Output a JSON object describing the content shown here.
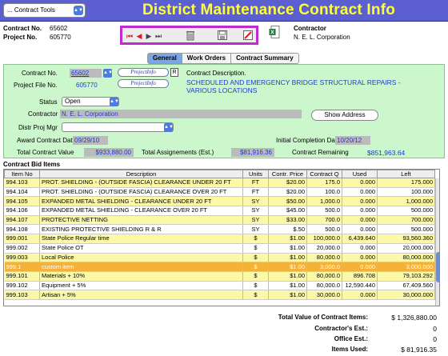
{
  "toolbar_menu": {
    "label": "... Contract Tools"
  },
  "title": "District Maintenance Contract Info",
  "header": {
    "contract_no_label": "Contract No.",
    "contract_no": "65602",
    "project_no_label": "Project No.",
    "project_no": "605770",
    "contractor_label": "Contractor",
    "contractor": "N. E. L. Corporation"
  },
  "nav_buttons": {
    "first": "⏮",
    "prev": "◀",
    "next": "▶",
    "last": "⏭"
  },
  "tabs": [
    {
      "label": "General"
    },
    {
      "label": "Work Orders"
    },
    {
      "label": "Contract Summary"
    }
  ],
  "form": {
    "contract_no_label": "Contract No.",
    "contract_no": "65602",
    "projectinfo_logo": "ProjectInfo",
    "r_label": "R",
    "contract_description_label": "Contract Description.",
    "project_file_no_label": "Project File No.",
    "project_file_no": "605770",
    "description": "SCHEDULED AND EMERGENCY BRIDGE STRUCTURAL REPAIRS - VARIOUS LOCATIONS",
    "status_label": "Status",
    "status_value": "Open",
    "contractor_label": "Contractor",
    "contractor_value": "N. E. L. Corporation",
    "show_address": "Show Address",
    "distr_proj_mgr_label": "Distr Proj Mgr",
    "distr_proj_mgr_value": "",
    "award_date_label": "Award Contract Date",
    "award_date": "09/29/10",
    "completion_date_label": "Initial Completion Date",
    "completion_date": "10/20/12",
    "total_value_label": "Total Contract Value",
    "total_value": "$933,880.00",
    "total_assign_label": "Total Assignements (Est.)",
    "total_assign": "$81,916.36",
    "contract_remaining_label": "Contract Remaining",
    "contract_remaining": "$851,963.64"
  },
  "bid_items": {
    "title": "Contract Bid Items",
    "columns": [
      "Item No",
      "Description",
      "Units",
      "Contr. Price",
      "Contract Q",
      "Used",
      "Left"
    ],
    "rows": [
      {
        "item": "994.103",
        "desc": "PROT. SHIELDING - (OUTSIDE FASCIA) CLEARANCE UNDER 20 FT",
        "units": "FT",
        "price": "$20.00",
        "qty": "175.0",
        "used": "0.000",
        "left": "175.000",
        "style": "yellow"
      },
      {
        "item": "994.104",
        "desc": "PROT. SHIELDING - (OUTSIDE FASCIA) CLEARANCE OVER 20 FT",
        "units": "FT",
        "price": "$20.00",
        "qty": "100.0",
        "used": "0.000",
        "left": "100.000",
        "style": "white"
      },
      {
        "item": "994.105",
        "desc": "EXPANDED METAL SHIELDING - CLEARANCE UNDER 20 FT",
        "units": "SY",
        "price": "$50.00",
        "qty": "1,000.0",
        "used": "0.000",
        "left": "1,000.000",
        "style": "yellow"
      },
      {
        "item": "994.106",
        "desc": "EXPANDED METAL SHIELDING - CLEARANCE OVER 20 FT",
        "units": "SY",
        "price": "$45.00",
        "qty": "500.0",
        "used": "0.000",
        "left": "500.000",
        "style": "white"
      },
      {
        "item": "994.107",
        "desc": "PROTECTIVE NETTING",
        "units": "SY",
        "price": "$33.00",
        "qty": "700.0",
        "used": "0.000",
        "left": "700.000",
        "style": "yellow"
      },
      {
        "item": "994.108",
        "desc": "EXISTING PROTECTIVE SHIELDING R & R",
        "units": "SY",
        "price": "$.50",
        "qty": "500.0",
        "used": "0.000",
        "left": "500.000",
        "style": "white"
      },
      {
        "item": "999.001",
        "desc": "State Police Regular time",
        "units": "$",
        "price": "$1.00",
        "qty": "100,000.0",
        "used": "6,439.640",
        "left": "93,560.360",
        "style": "yellow"
      },
      {
        "item": "999.002",
        "desc": "State Police OT",
        "units": "$",
        "price": "$1.00",
        "qty": "20,000.0",
        "used": "0.000",
        "left": "20,000.000",
        "style": "white"
      },
      {
        "item": "999.003",
        "desc": "Local Police",
        "units": "$",
        "price": "$1.00",
        "qty": "80,000.0",
        "used": "0.000",
        "left": "80,000.000",
        "style": "yellow"
      },
      {
        "item": "999.1",
        "desc": "custom item",
        "units": "$",
        "price": "$1.00",
        "qty": "3,000.0",
        "used": "0.000",
        "left": "3,000.000",
        "style": "orange"
      },
      {
        "item": "999.101",
        "desc": "Materials + 10%",
        "units": "$",
        "price": "$1.00",
        "qty": "80,000.0",
        "used": "896.708",
        "left": "79,103.292",
        "style": "yellow"
      },
      {
        "item": "999.102",
        "desc": "Equipment + 5%",
        "units": "$",
        "price": "$1.00",
        "qty": "80,000.0",
        "used": "12,590.440",
        "left": "67,409.560",
        "style": "white"
      },
      {
        "item": "999.103",
        "desc": "Artisan + 5%",
        "units": "$",
        "price": "$1.00",
        "qty": "30,000.0",
        "used": "0.000",
        "left": "30,000.000",
        "style": "yellow"
      }
    ]
  },
  "totals": {
    "total_value_label": "Total Value of  Contract Items:",
    "total_value": "$ 1,326,880.00",
    "contractor_est_label": "Contractor's Est.:",
    "contractor_est": "0",
    "office_est_label": "Office Est.:",
    "office_est": "0",
    "items_used_label": "Items Used:",
    "items_used": "$ 81,916.35"
  }
}
